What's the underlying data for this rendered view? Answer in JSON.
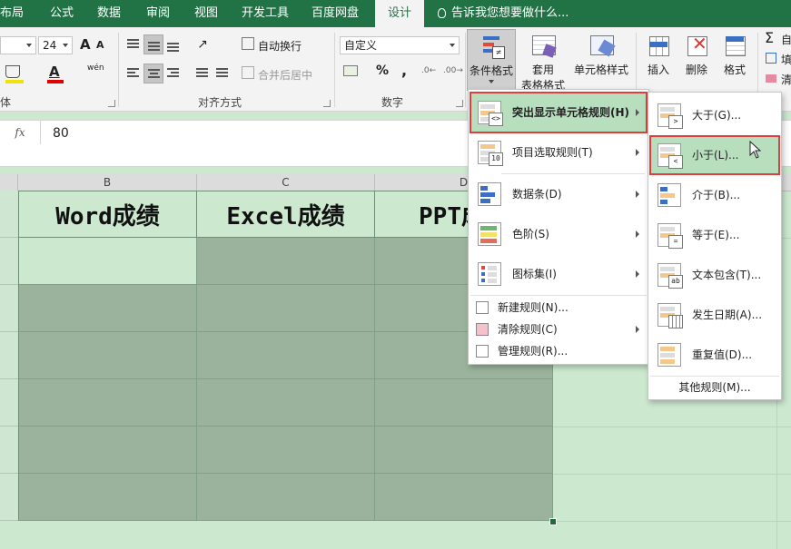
{
  "ribbon_tabs": [
    "布局",
    "公式",
    "数据",
    "审阅",
    "视图",
    "开发工具",
    "百度网盘",
    "设计"
  ],
  "tell_me": "告诉我您想要做什么...",
  "font": {
    "size": "24",
    "size_up": "A",
    "size_down": "A",
    "font_color_glyph": "A",
    "phonetic": "wén"
  },
  "groups": {
    "font_label_partial": "体",
    "align_label": "对齐方式",
    "number_label": "数字"
  },
  "alignment": {
    "wrap_text": "自动换行",
    "merge_center": "合并后居中"
  },
  "number": {
    "format": "自定义",
    "percent": "%",
    "comma": ","
  },
  "styles": {
    "conditional_format": "条件格式",
    "table_format_line1": "套用",
    "table_format_line2": "表格格式",
    "cell_styles": "单元格样式"
  },
  "cells": {
    "insert": "插入",
    "delete": "删除",
    "format": "格式"
  },
  "editing": {
    "autosum_partial": "自",
    "fill_partial": "填",
    "clear_partial": "清"
  },
  "formula_bar": {
    "fx": "fx",
    "value": "80"
  },
  "columns": [
    "B",
    "C",
    "D"
  ],
  "sheet": {
    "headers": [
      "Word成绩",
      "Excel成绩",
      "PPT成绩"
    ]
  },
  "cf_menu": {
    "items": [
      {
        "label": "突出显示单元格规则(H)",
        "key": "H"
      },
      {
        "label": "项目选取规则(T)",
        "key": "T"
      },
      {
        "label": "数据条(D)",
        "key": "D"
      },
      {
        "label": "色阶(S)",
        "key": "S"
      },
      {
        "label": "图标集(I)",
        "key": "I"
      }
    ],
    "small_items": [
      {
        "label": "新建规则(N)..."
      },
      {
        "label": "清除规则(C)"
      },
      {
        "label": "管理规则(R)..."
      }
    ]
  },
  "highlight_menu": {
    "items": [
      {
        "label": "大于(G)...",
        "tag": ">"
      },
      {
        "label": "小于(L)...",
        "tag": "<"
      },
      {
        "label": "介于(B)...",
        "tag": ""
      },
      {
        "label": "等于(E)...",
        "tag": "="
      },
      {
        "label": "文本包含(T)...",
        "tag": "ab"
      },
      {
        "label": "发生日期(A)...",
        "tag": ""
      },
      {
        "label": "重复值(D)...",
        "tag": ""
      }
    ],
    "more": "其他规则(M)..."
  },
  "colors": {
    "ribbon_green": "#217346",
    "sheet_bg": "#cce8cf",
    "cell_dark": "#9bb39d",
    "menu_hover": "#b7dfbd",
    "highlight_red": "#e23d3d"
  }
}
